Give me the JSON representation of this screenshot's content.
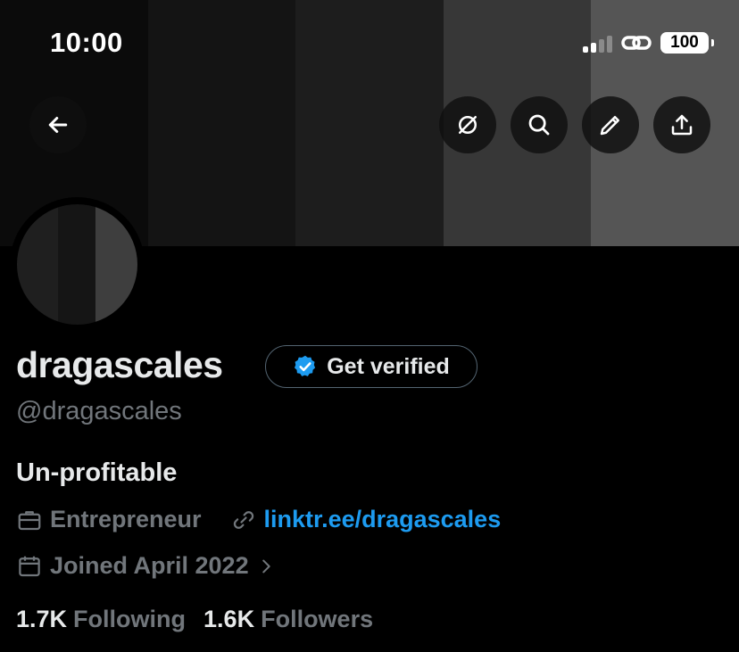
{
  "status_bar": {
    "time": "10:00",
    "battery": "100"
  },
  "profile": {
    "display_name": "dragascales",
    "get_verified_label": "Get verified",
    "handle": "@dragascales",
    "bio": "Un-profitable",
    "category": "Entrepreneur",
    "link": "linktr.ee/dragascales",
    "joined": "Joined April 2022"
  },
  "stats": {
    "following_count": "1.7K",
    "following_label": "Following",
    "followers_count": "1.6K",
    "followers_label": "Followers"
  },
  "colors": {
    "accent": "#1d9bf0",
    "muted": "#71767b",
    "text": "#e7e9ea",
    "background": "#000000"
  },
  "icons": [
    "back-arrow-icon",
    "grok-icon",
    "search-icon",
    "edit-icon",
    "share-icon",
    "verified-badge-icon",
    "briefcase-icon",
    "link-icon",
    "calendar-icon",
    "chevron-right-icon",
    "wifi-icon"
  ]
}
